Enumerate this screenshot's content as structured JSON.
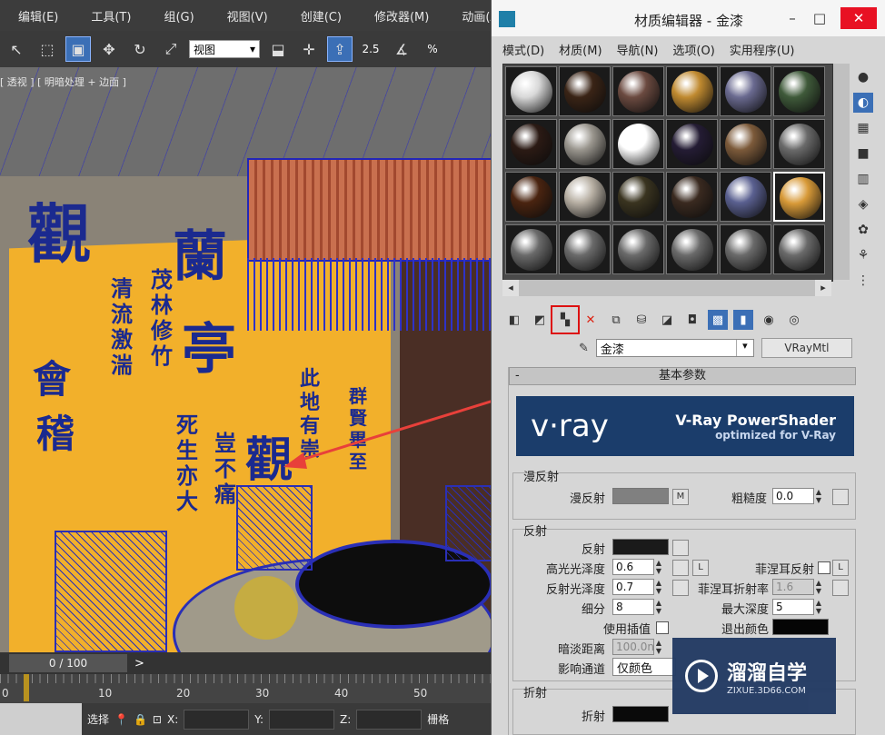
{
  "main_window": {
    "menu": [
      "编辑(E)",
      "工具(T)",
      "组(G)",
      "视图(V)",
      "创建(C)",
      "修改器(M)",
      "动画(A)"
    ],
    "toolbar": {
      "view_select": "视图",
      "snap_label": "2.5",
      "percent_label": "%"
    },
    "viewport_label": "[ 透视 ] [ 明暗处理 + 边面 ]",
    "timeline": {
      "frame": "0 / 100",
      "next": ">"
    },
    "ruler_ticks": [
      "0",
      "10",
      "20",
      "30",
      "40",
      "50"
    ],
    "status": {
      "select_label": "选择",
      "x_label": "X:",
      "y_label": "Y:",
      "z_label": "Z:",
      "grid_label": "栅格"
    }
  },
  "material_editor": {
    "title": "材质编辑器 - 金漆",
    "window_buttons": {
      "minimize": "–",
      "maximize": "□",
      "close": "✕"
    },
    "menu": [
      "模式(D)",
      "材质(M)",
      "导航(N)",
      "选项(O)",
      "实用程序(U)"
    ],
    "material_name": "金漆",
    "material_type": "VRayMtl",
    "rollout_title": "基本参数",
    "vray_banner": {
      "logo": "v·ray",
      "title": "V-Ray PowerShader",
      "subtitle": "optimized for V-Ray"
    },
    "diffuse_group": {
      "title": "漫反射",
      "diffuse_label": "漫反射",
      "m_button": "M",
      "roughness_label": "粗糙度",
      "roughness_value": "0.0"
    },
    "reflection_group": {
      "title": "反射",
      "reflect_label": "反射",
      "hilight_gloss_label": "高光光泽度",
      "hilight_gloss_value": "0.6",
      "l_button": "L",
      "fresnel_label": "菲涅耳反射",
      "refl_gloss_label": "反射光泽度",
      "refl_gloss_value": "0.7",
      "fresnel_ior_label": "菲涅耳折射率",
      "fresnel_ior_value": "1.6",
      "subdivs_label": "细分",
      "subdivs_value": "8",
      "max_depth_label": "最大深度",
      "max_depth_value": "5",
      "use_interp_label": "使用插值",
      "exit_color_label": "退出颜色",
      "dim_distance_label": "暗淡距离",
      "dim_distance_value": "100.0n",
      "affect_channels_label": "影响通道",
      "affect_channels_value": "仅颜色"
    },
    "refraction_group": {
      "title": "折射",
      "refract_label": "折射"
    },
    "sample_slot_colors": [
      [
        "#d8d8d8",
        "#3a2416",
        "#6b4a40",
        "#c08a30",
        "#6a6a90",
        "#3f5a3a"
      ],
      [
        "#2b1a14",
        "#9a968e",
        "#ffffff",
        "#241c34",
        "#7c5a3a",
        "#6a6a6a"
      ],
      [
        "#4a2410",
        "#b8b0a4",
        "#3a3420",
        "#3a2a20",
        "#5a6090",
        "#d89a38"
      ],
      [
        "#6a6a6a",
        "#6a6a6a",
        "#6a6a6a",
        "#6a6a6a",
        "#6a6a6a",
        "#6a6a6a"
      ]
    ]
  },
  "watermark": {
    "name": "溜溜自学",
    "url": "ZIXUE.3D66.COM"
  }
}
